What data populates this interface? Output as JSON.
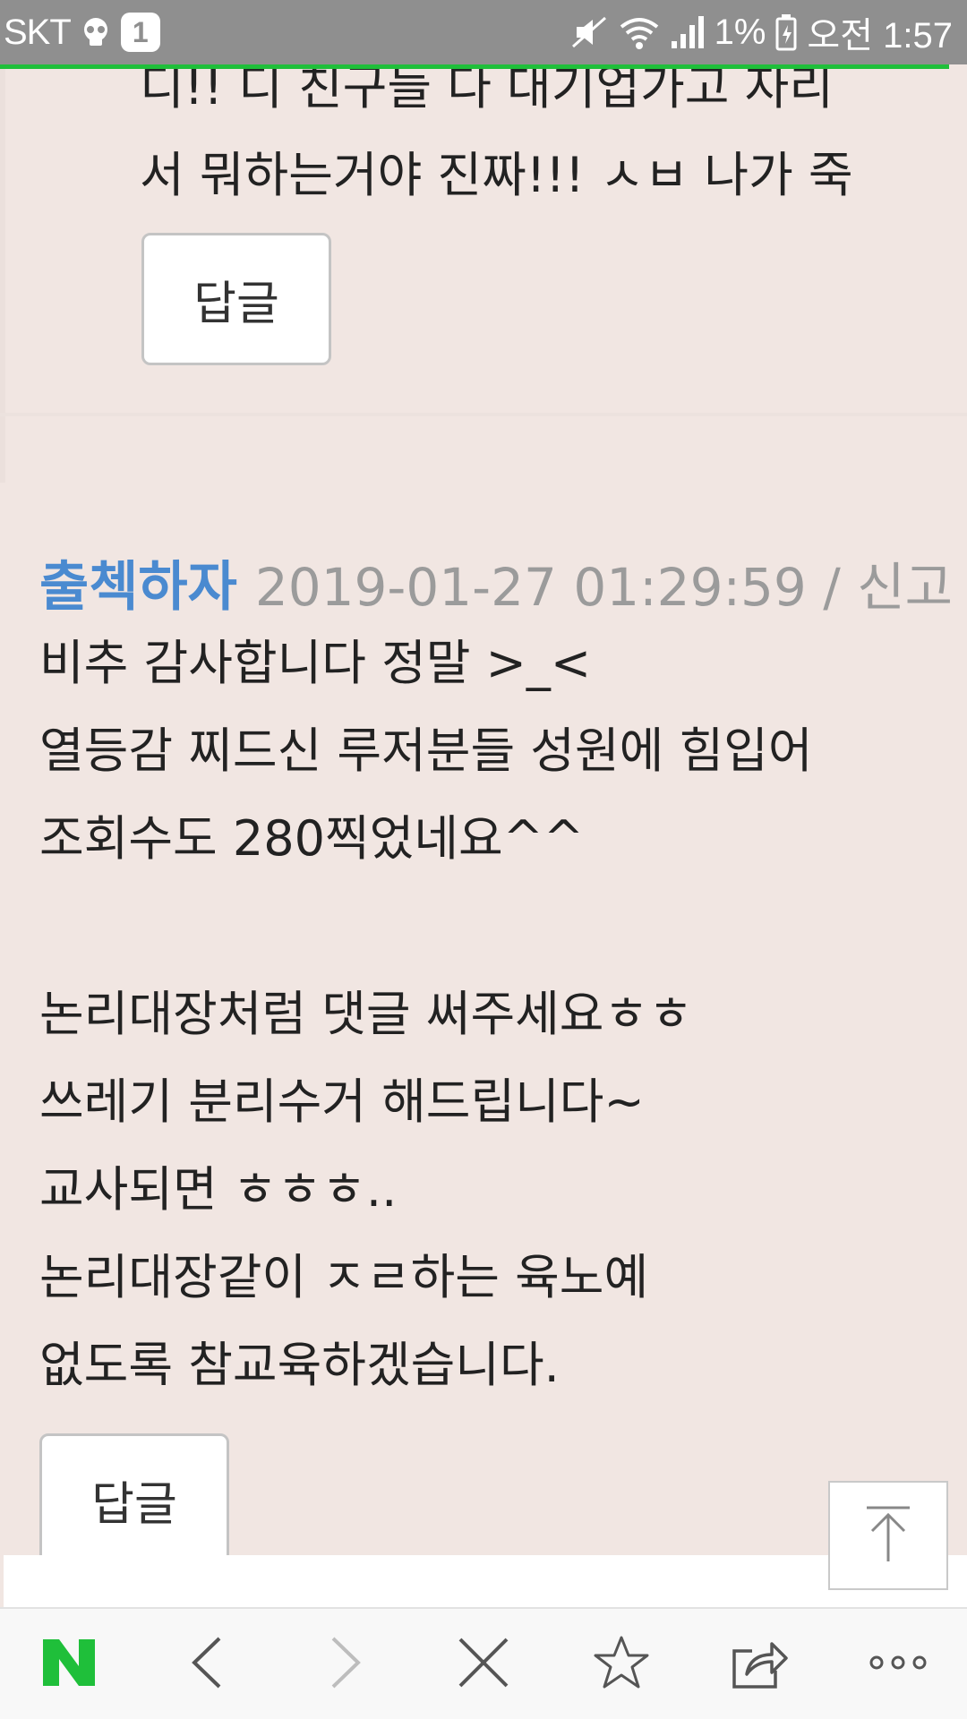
{
  "status_bar": {
    "carrier": "SKT",
    "notification_count": "1",
    "battery": "1%",
    "time": "오전 1:57"
  },
  "nested_comment": {
    "lines": [
      "디!! 디 친구들 다 대기업가고 자리",
      "서 뭐하는거야 진짜!!! ㅅㅂ 나가 죽"
    ],
    "reply_label": "답글"
  },
  "main_comment": {
    "author": "출첵하자",
    "datetime": "2019-01-27 01:29:59",
    "divider": " / ",
    "report_label": "신고",
    "lines": [
      "비추 감사합니다 정말 >_<",
      "열등감 찌드신 루저분들 성원에 힘입어",
      "조회수도 280찍었네요^^",
      "",
      "논리대장처럼 댓글 써주세요ㅎㅎ",
      "쓰레기 분리수거 해드립니다~",
      "교사되면 ㅎㅎㅎ..",
      "논리대장같이 ㅈㄹ하는 육노예",
      "없도록 참교육하겠습니다."
    ],
    "reply_label": "답글"
  },
  "bottom_nav": {
    "items": [
      "naver-home",
      "back",
      "forward",
      "close",
      "bookmark",
      "share",
      "more"
    ]
  },
  "colors": {
    "accent_green": "#1fbf3a",
    "author_blue": "#4a8ad0",
    "comment_bg": "#f1e6e2"
  }
}
